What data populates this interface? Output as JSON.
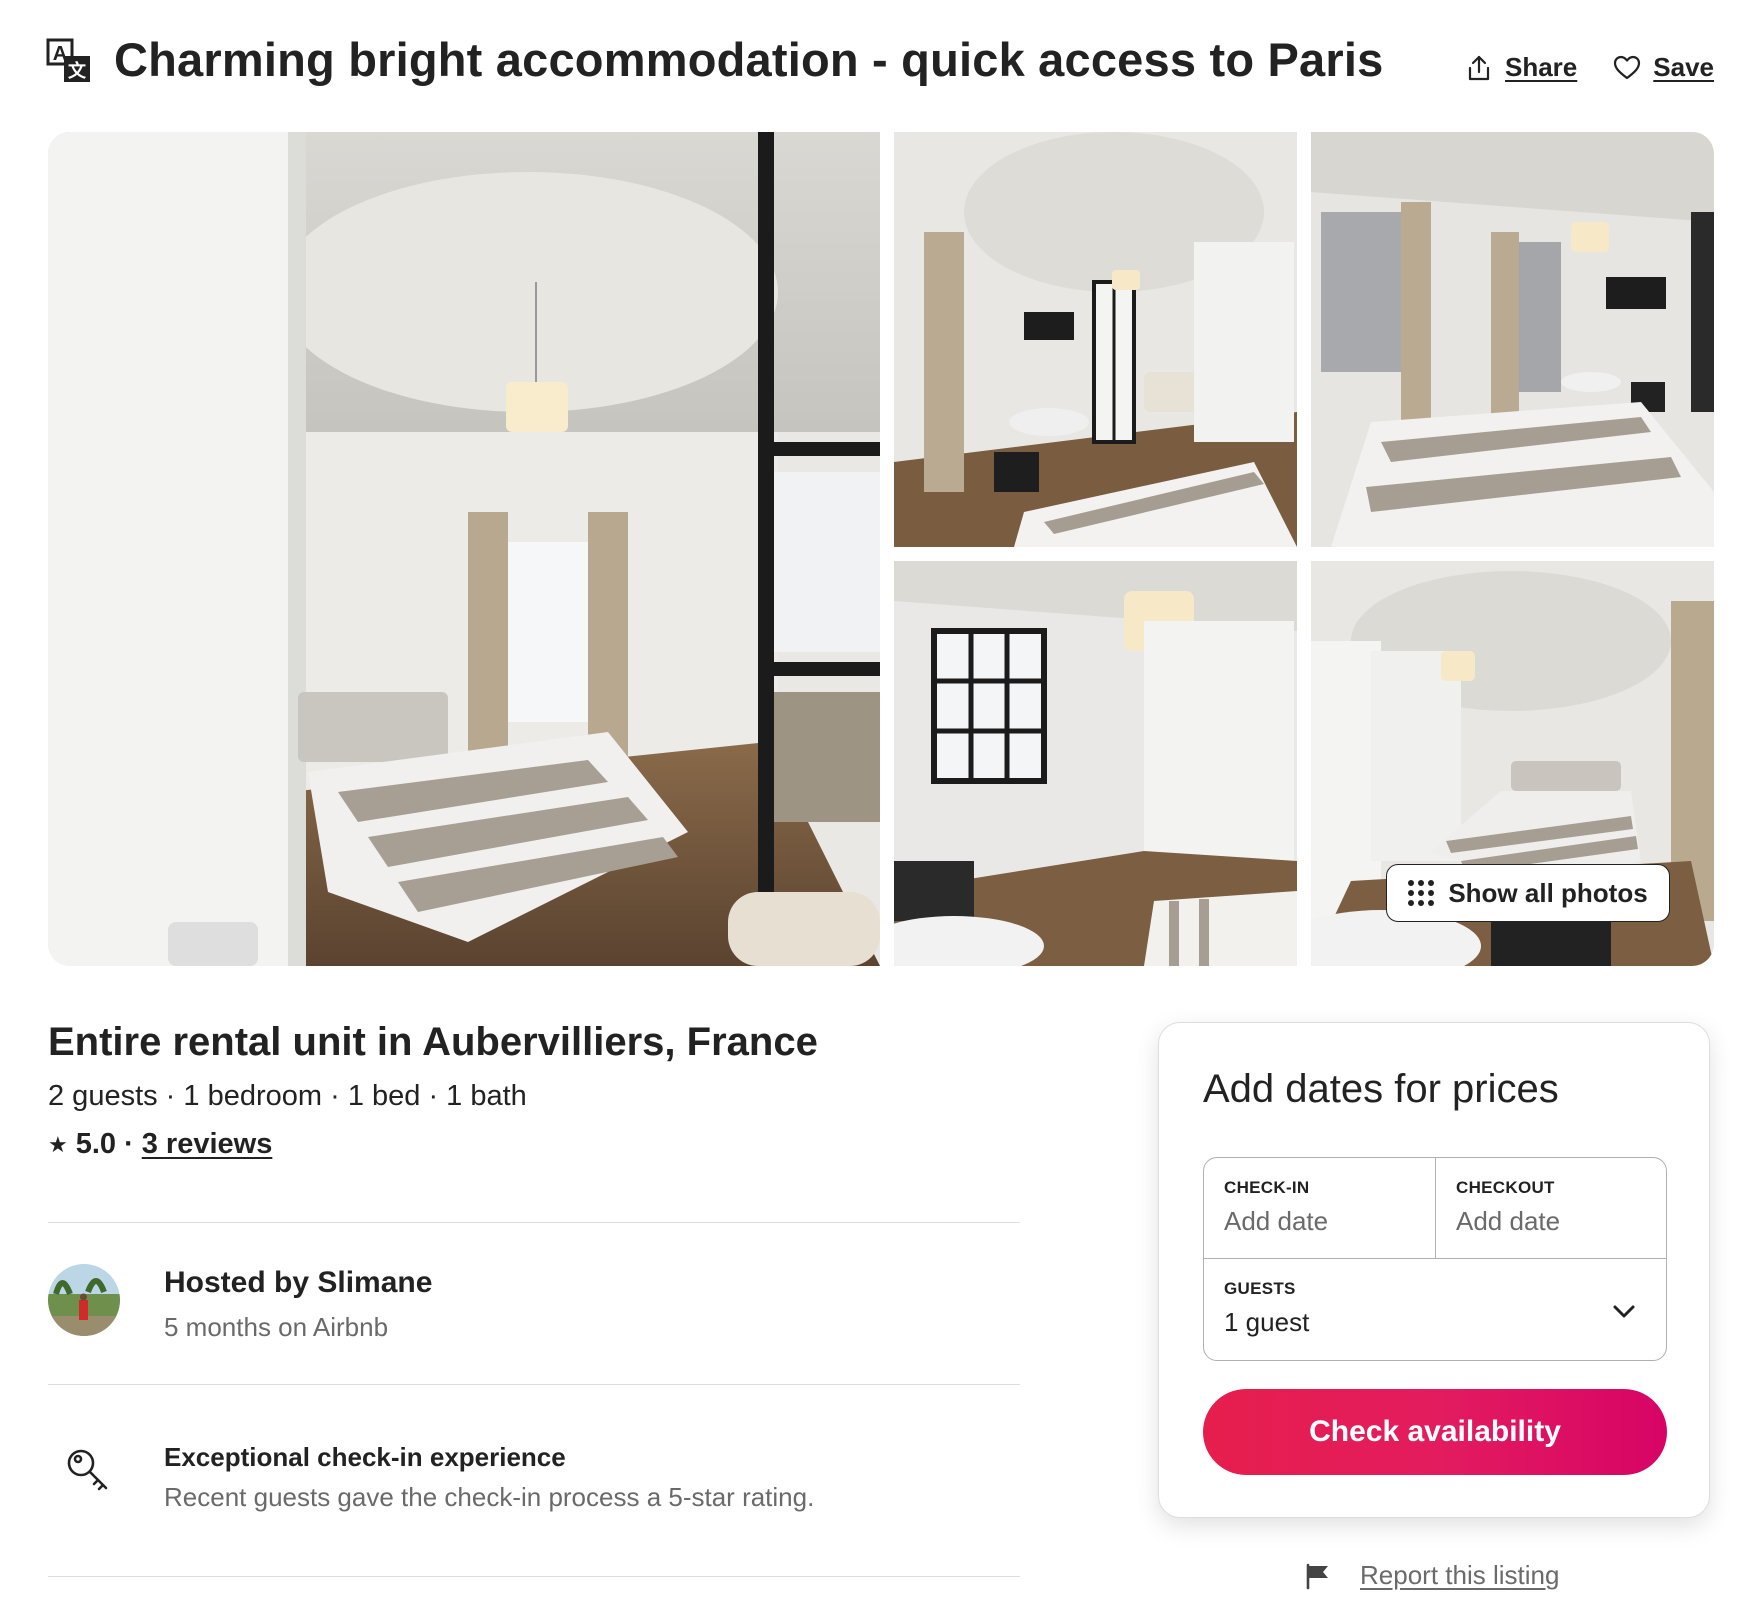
{
  "header": {
    "title": "Charming bright accommodation - quick access to Paris",
    "share_label": "Share",
    "save_label": "Save",
    "translate_icon": "translate-icon"
  },
  "gallery": {
    "show_all_label": "Show all photos",
    "photos": [
      {
        "name": "main-bedroom-photo"
      },
      {
        "name": "living-area-photo"
      },
      {
        "name": "bed-window-photo"
      },
      {
        "name": "glass-partition-photo"
      },
      {
        "name": "bedroom-overview-photo"
      }
    ]
  },
  "listing": {
    "subtitle": "Entire rental unit in Aubervilliers, France",
    "details": "2 guests · 1 bedroom · 1 bed · 1 bath",
    "rating_value": "5.0",
    "rating_separator": "·",
    "reviews_label": "3 reviews"
  },
  "host": {
    "name": "Hosted by Slimane",
    "since": "5 months on Airbnb"
  },
  "feature": {
    "title": "Exceptional check-in experience",
    "description": "Recent guests gave the check-in process a 5-star rating."
  },
  "booking": {
    "title": "Add dates for prices",
    "checkin_label": "CHECK-IN",
    "checkin_value": "Add date",
    "checkout_label": "CHECKOUT",
    "checkout_value": "Add date",
    "guests_label": "GUESTS",
    "guests_value": "1 guest",
    "cta_label": "Check availability",
    "cta_color": "#e61e4d"
  },
  "report": {
    "label": "Report this listing"
  }
}
